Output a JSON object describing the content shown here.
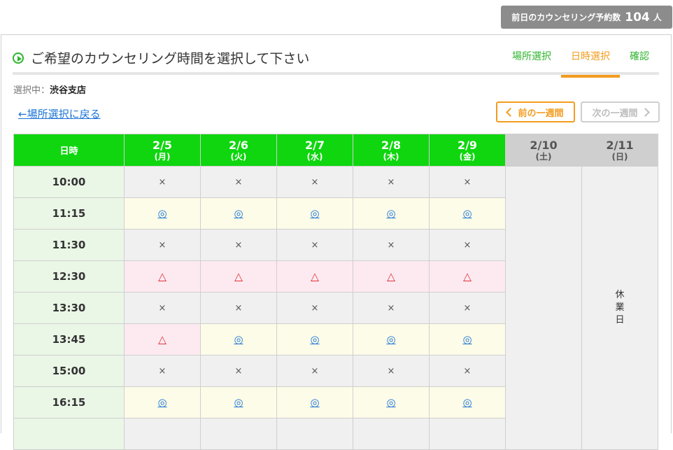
{
  "badge": {
    "prefix": "前日のカウンセリング予約数",
    "count": "104",
    "unit": "人"
  },
  "header": {
    "title": "ご希望のカウンセリング時間を選択して下さい",
    "steps": [
      {
        "label": "場所選択",
        "active": false
      },
      {
        "label": "日時選択",
        "active": true
      },
      {
        "label": "確認",
        "active": false
      }
    ]
  },
  "selection": {
    "label": "選択中：",
    "value": "渋谷支店"
  },
  "back_link": "←場所選択に戻る",
  "week_nav": {
    "prev": "前の一週間",
    "next": "次の一週間"
  },
  "table": {
    "corner_label": "日時",
    "days": [
      {
        "date": "2/5",
        "weekday": "(月)",
        "open": true
      },
      {
        "date": "2/6",
        "weekday": "(火)",
        "open": true
      },
      {
        "date": "2/7",
        "weekday": "(水)",
        "open": true
      },
      {
        "date": "2/8",
        "weekday": "(木)",
        "open": true
      },
      {
        "date": "2/9",
        "weekday": "(金)",
        "open": true
      },
      {
        "date": "2/10",
        "weekday": "(土)",
        "open": false
      },
      {
        "date": "2/11",
        "weekday": "(日)",
        "open": false
      }
    ],
    "closed_label": "休業日",
    "rows": [
      {
        "time": "10:00",
        "slots": [
          "×",
          "×",
          "×",
          "×",
          "×"
        ]
      },
      {
        "time": "11:15",
        "slots": [
          "◎",
          "◎",
          "◎",
          "◎",
          "◎"
        ]
      },
      {
        "time": "11:30",
        "slots": [
          "×",
          "×",
          "×",
          "×",
          "×"
        ]
      },
      {
        "time": "12:30",
        "slots": [
          "△",
          "△",
          "△",
          "△",
          "△"
        ]
      },
      {
        "time": "13:30",
        "slots": [
          "×",
          "×",
          "×",
          "×",
          "×"
        ]
      },
      {
        "time": "13:45",
        "slots": [
          "△",
          "◎",
          "◎",
          "◎",
          "◎"
        ]
      },
      {
        "time": "15:00",
        "slots": [
          "×",
          "×",
          "×",
          "×",
          "×"
        ]
      },
      {
        "time": "16:15",
        "slots": [
          "◎",
          "◎",
          "◎",
          "◎",
          "◎"
        ]
      },
      {
        "time": "",
        "slots": [
          "",
          "",
          "",
          "",
          ""
        ]
      }
    ]
  },
  "colors": {
    "header_green": "#0fd60f",
    "step_green": "#2db52d",
    "accent_orange": "#f39c1f",
    "link_blue": "#1a73d6",
    "triangle_red": "#e0303a"
  }
}
